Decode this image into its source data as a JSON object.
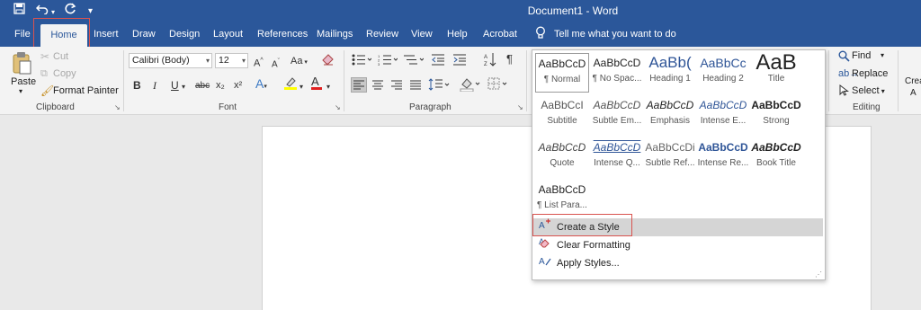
{
  "titlebar": {
    "document_title": "Document1  -  Word",
    "save_icon": "save-icon",
    "undo_icon": "undo-icon",
    "redo_icon": "redo-icon",
    "customize_icon": "customize-quick-access-icon"
  },
  "tabs": [
    {
      "label": "File"
    },
    {
      "label": "Home"
    },
    {
      "label": "Insert"
    },
    {
      "label": "Draw"
    },
    {
      "label": "Design"
    },
    {
      "label": "Layout"
    },
    {
      "label": "References"
    },
    {
      "label": "Mailings"
    },
    {
      "label": "Review"
    },
    {
      "label": "View"
    },
    {
      "label": "Help"
    },
    {
      "label": "Acrobat"
    }
  ],
  "tell_me": "Tell me what you want to do",
  "clipboard": {
    "paste": "Paste",
    "cut": "Cut",
    "copy": "Copy",
    "format_painter": "Format Painter",
    "group_label": "Clipboard"
  },
  "font": {
    "font_name": "Calibri (Body)",
    "font_size": "12",
    "bold": "B",
    "italic": "I",
    "underline": "U",
    "strike": "abc",
    "subscript": "x₂",
    "superscript": "x²",
    "grow": "A",
    "shrink": "A",
    "case": "Aa",
    "group_label": "Font"
  },
  "paragraph": {
    "group_label": "Paragraph"
  },
  "styles": {
    "gallery": [
      {
        "preview": "AaBbCcD",
        "name": "¶ Normal"
      },
      {
        "preview": "AaBbCcD",
        "name": "¶ No Spac..."
      },
      {
        "preview": "AaBb(",
        "name": "Heading 1"
      },
      {
        "preview": "AaBbCc",
        "name": "Heading 2"
      },
      {
        "preview": "AaB",
        "name": "Title"
      },
      {
        "preview": "AaBbCcI",
        "name": "Subtitle"
      },
      {
        "preview": "AaBbCcD",
        "name": "Subtle Em..."
      },
      {
        "preview": "AaBbCcD",
        "name": "Emphasis"
      },
      {
        "preview": "AaBbCcD",
        "name": "Intense E..."
      },
      {
        "preview": "AaBbCcD",
        "name": "Strong"
      },
      {
        "preview": "AaBbCcD",
        "name": "Quote"
      },
      {
        "preview": "AaBbCcD",
        "name": "Intense Q..."
      },
      {
        "preview": "AaBbCcDi",
        "name": "Subtle Ref..."
      },
      {
        "preview": "AaBbCcD",
        "name": "Intense Re..."
      },
      {
        "preview": "AaBbCcD",
        "name": "Book Title"
      },
      {
        "preview": "AaBbCcD",
        "name": "¶ List Para..."
      }
    ],
    "menu": {
      "create_style": "Create a Style",
      "clear_formatting": "Clear Formatting",
      "apply_styles": "Apply Styles..."
    }
  },
  "editing": {
    "find": "Find",
    "replace": "Replace",
    "select": "Select",
    "group_label": "Editing"
  },
  "partial_right": {
    "label_line1": "Crea",
    "label_line2": "A"
  },
  "colors": {
    "ribbon_blue": "#2b579a",
    "highlight_red": "#d9534f",
    "menu_hover_gray": "#d5d5d5"
  }
}
